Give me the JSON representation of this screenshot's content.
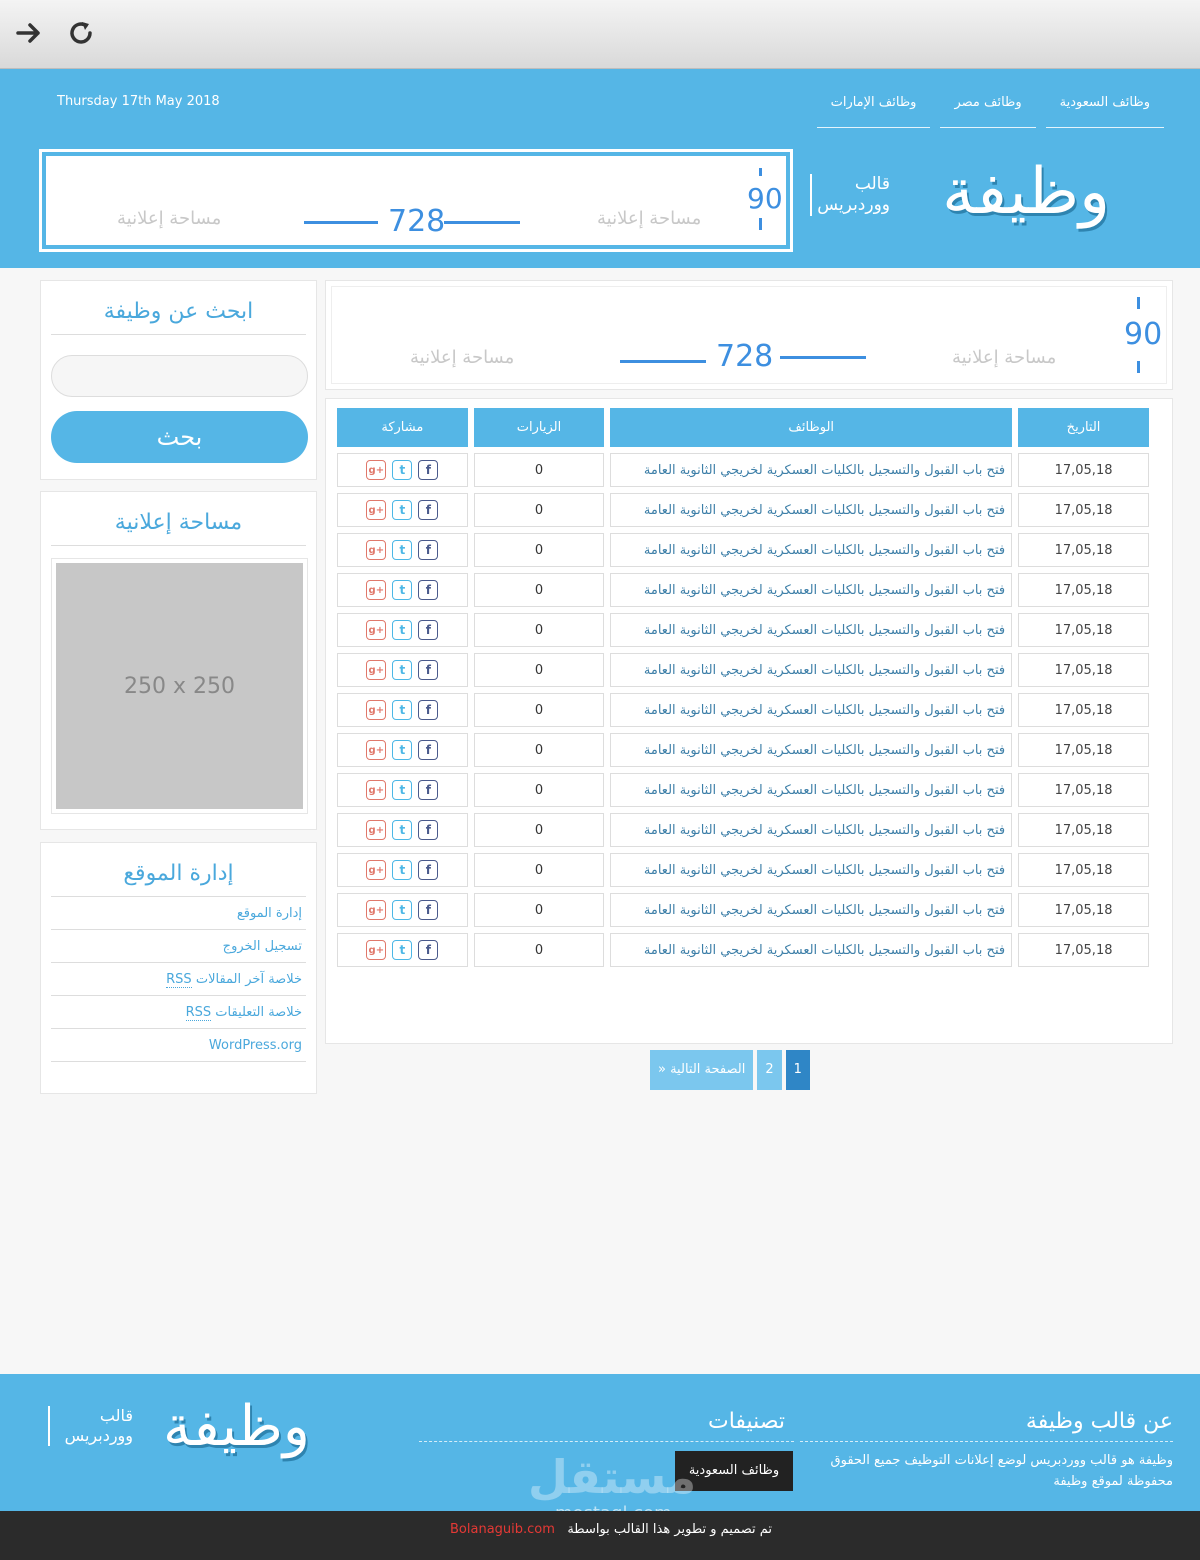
{
  "header": {
    "date": "Thursday 17th May 2018",
    "nav": [
      "وظائف السعودية",
      "وظائف مصر",
      "وظائف الإمارات"
    ],
    "logo": "وظيفة",
    "logo_sub": "قالب ووردبريس"
  },
  "ad": {
    "height": "90",
    "width": "728",
    "label": "مساحة إعلانية"
  },
  "table": {
    "headers": [
      "التاريخ",
      "الوظائف",
      "الزيارات",
      "مشاركة"
    ],
    "rows": [
      {
        "date": "17,05,18",
        "title": "فتح باب القبول والتسجيل بالكليات العسكرية لخريجي الثانوية العامة",
        "visits": "0"
      },
      {
        "date": "17,05,18",
        "title": "فتح باب القبول والتسجيل بالكليات العسكرية لخريجي الثانوية العامة",
        "visits": "0"
      },
      {
        "date": "17,05,18",
        "title": "فتح باب القبول والتسجيل بالكليات العسكرية لخريجي الثانوية العامة",
        "visits": "0"
      },
      {
        "date": "17,05,18",
        "title": "فتح باب القبول والتسجيل بالكليات العسكرية لخريجي الثانوية العامة",
        "visits": "0"
      },
      {
        "date": "17,05,18",
        "title": "فتح باب القبول والتسجيل بالكليات العسكرية لخريجي الثانوية العامة",
        "visits": "0"
      },
      {
        "date": "17,05,18",
        "title": "فتح باب القبول والتسجيل بالكليات العسكرية لخريجي الثانوية العامة",
        "visits": "0"
      },
      {
        "date": "17,05,18",
        "title": "فتح باب القبول والتسجيل بالكليات العسكرية لخريجي الثانوية العامة",
        "visits": "0"
      },
      {
        "date": "17,05,18",
        "title": "فتح باب القبول والتسجيل بالكليات العسكرية لخريجي الثانوية العامة",
        "visits": "0"
      },
      {
        "date": "17,05,18",
        "title": "فتح باب القبول والتسجيل بالكليات العسكرية لخريجي الثانوية العامة",
        "visits": "0"
      },
      {
        "date": "17,05,18",
        "title": "فتح باب القبول والتسجيل بالكليات العسكرية لخريجي الثانوية العامة",
        "visits": "0"
      },
      {
        "date": "17,05,18",
        "title": "فتح باب القبول والتسجيل بالكليات العسكرية لخريجي الثانوية العامة",
        "visits": "0"
      },
      {
        "date": "17,05,18",
        "title": "فتح باب القبول والتسجيل بالكليات العسكرية لخريجي الثانوية العامة",
        "visits": "0"
      },
      {
        "date": "17,05,18",
        "title": "فتح باب القبول والتسجيل بالكليات العسكرية لخريجي الثانوية العامة",
        "visits": "0"
      }
    ],
    "share_icons": {
      "fb": "f",
      "tw": "t",
      "gp": "g+"
    }
  },
  "pagination": {
    "current": "1",
    "page2": "2",
    "next": "الصفحة التالية «"
  },
  "sidebar": {
    "search_title": "ابحث عن وظيفة",
    "search_button": "بحث",
    "ad_title": "مساحة إعلانية",
    "ad_placeholder": "250 x 250",
    "admin_title": "إدارة الموقع",
    "admin_links": [
      "إدارة الموقع",
      "تسجيل الخروج",
      "خلاصة آخر المقالات",
      "خلاصة التعليقات",
      "WordPress.org"
    ],
    "rss": "RSS"
  },
  "footer": {
    "about_title": "عن قالب وظيفة",
    "about_text": "وظيفة هو قالب ووردبريس لوضع إعلانات التوظيف جميع الحقوق محفوظة لموقع وظيفة",
    "categories_title": "تصنيفات",
    "category": "وظائف السعودية",
    "logo": "وظيفة",
    "logo_sub": "قالب ووردبريس",
    "watermark": "مستقل",
    "watermark_sub": "mostaql.com",
    "credit": "تم تصميم و تطوير هذا القالب بواسطة",
    "credit_author": "Bolanaguib.com"
  },
  "colors": {
    "primary": "#55b6e6",
    "accent": "#3d8fe0",
    "dark": "#2b2b2b"
  }
}
